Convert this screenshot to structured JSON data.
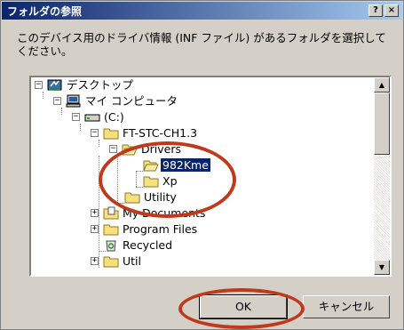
{
  "window": {
    "title": "フォルダの参照",
    "help_label": "?",
    "close_label": "×"
  },
  "instruction": "このデバイス用のドライバ情報 (INF ファイル) があるフォルダを選択してください。",
  "tree": {
    "items": [
      {
        "label": "デスクトップ",
        "expander": "−",
        "icon": "desktop-icon"
      },
      {
        "label": "マイ コンピュータ",
        "expander": "−",
        "icon": "my-computer-icon"
      },
      {
        "label": "(C:)",
        "expander": "−",
        "icon": "hard-drive-icon"
      },
      {
        "label": "FT-STC-CH1.3",
        "expander": "−",
        "icon": "folder-icon"
      },
      {
        "label": "Drivers",
        "expander": "−",
        "icon": "folder-open-icon"
      },
      {
        "label": "982Kme",
        "expander": "",
        "icon": "folder-open-icon",
        "selected": true
      },
      {
        "label": "Xp",
        "expander": "",
        "icon": "folder-icon"
      },
      {
        "label": "Utility",
        "expander": "",
        "icon": "folder-icon"
      },
      {
        "label": "My Documents",
        "expander": "+",
        "icon": "my-documents-icon"
      },
      {
        "label": "Program Files",
        "expander": "+",
        "icon": "folder-icon"
      },
      {
        "label": "Recycled",
        "expander": "",
        "icon": "recycle-bin-icon"
      },
      {
        "label": "Util",
        "expander": "+",
        "icon": "folder-icon"
      }
    ]
  },
  "scrollbar": {
    "up_label": "▲",
    "down_label": "▼"
  },
  "buttons": {
    "ok_label": "OK",
    "cancel_label": "キャンセル"
  },
  "colors": {
    "annotation_ring": "#c0391b",
    "selection": "#0a246a",
    "folder": "#f8e07a"
  }
}
